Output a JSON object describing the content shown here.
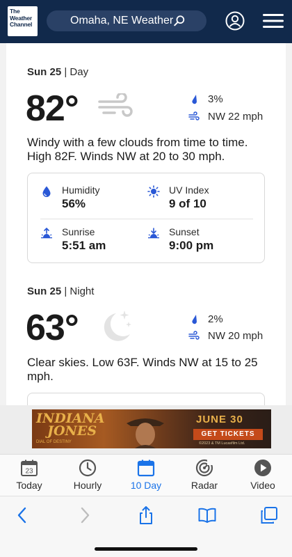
{
  "header": {
    "logo_line1": "The",
    "logo_line2": "Weather",
    "logo_line3": "Channel",
    "search_text": "Omaha, NE Weather"
  },
  "day": {
    "date": "Sun 25",
    "period": " | Day",
    "temp": "82°",
    "condition_icon": "wind-icon",
    "precip": "3%",
    "wind": "NW 22 mph",
    "description": "Windy with a few clouds from time to time. High 82F. Winds NW at 20 to 30 mph.",
    "humidity_label": "Humidity",
    "humidity_value": "56%",
    "uv_label": "UV Index",
    "uv_value": "9 of 10",
    "sunrise_label": "Sunrise",
    "sunrise_value": "5:51 am",
    "sunset_label": "Sunset",
    "sunset_value": "9:00 pm"
  },
  "night": {
    "date": "Sun 25",
    "period": " | Night",
    "temp": "63°",
    "condition_icon": "moon-stars-icon",
    "precip": "2%",
    "wind": "NW 20 mph",
    "description": "Clear skies. Low 63F. Winds NW at 15 to 25 mph."
  },
  "ad": {
    "title_line1": "INDIANA",
    "title_line2": "JONES",
    "subtitle": "DIAL OF DESTINY",
    "date": "JUNE 30",
    "cta": "GET TICKETS",
    "fine_print": "©2023 & TM Lucasfilm Ltd."
  },
  "tabs": [
    {
      "label": "Today",
      "icon": "calendar-day-icon",
      "badge": "23"
    },
    {
      "label": "Hourly",
      "icon": "clock-icon"
    },
    {
      "label": "10 Day",
      "icon": "calendar-icon",
      "active": true
    },
    {
      "label": "Radar",
      "icon": "radar-icon"
    },
    {
      "label": "Video",
      "icon": "play-circle-icon"
    }
  ],
  "colors": {
    "header_bg": "#11294b",
    "accent_blue": "#1a73e8",
    "icon_blue": "#2a58d6"
  }
}
